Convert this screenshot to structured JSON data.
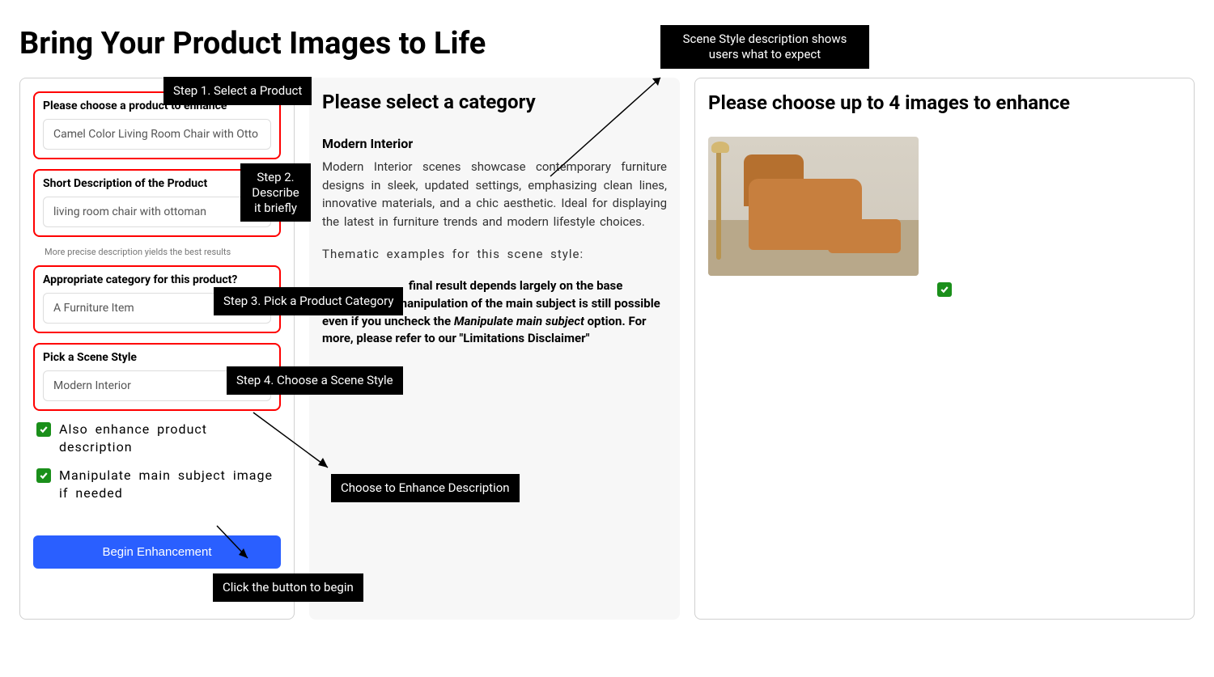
{
  "page_title": "Bring Your Product Images to Life",
  "left": {
    "product_label": "Please choose a product to enhance",
    "product_value": "Camel Color Living Room Chair with Otto",
    "desc_label": "Short Description of the Product",
    "desc_value": "living room chair with ottoman",
    "desc_helper": "More precise description yields the best results",
    "category_label": "Appropriate category for this product?",
    "category_value": "A Furniture Item",
    "scene_label": "Pick a Scene Style",
    "scene_value": "Modern Interior",
    "chk1": "Also enhance product description",
    "chk2": "Manipulate main subject image if needed",
    "begin_btn": "Begin Enhancement"
  },
  "middle": {
    "title": "Please select a category",
    "subtitle": "Modern Interior",
    "body": "Modern Interior scenes showcase contemporary furniture designs in sleek, updated settings, emphasizing clean lines, innovative materials, and a chic aesthetic. Ideal for displaying the latest in furniture trends and modern lifestyle choices.",
    "thematic": "Thematic examples for this scene style:",
    "note_pre": "final result depends largely on the base ",
    "note_mid1": "de. Some manipulation of the main subject is still possible even if you uncheck the ",
    "note_italic": "Manipulate main subject",
    "note_mid2": " option. For more, please refer to our \"Limitations Disclaimer\""
  },
  "right": {
    "title": "Please choose up to 4 images to enhance"
  },
  "callouts": {
    "top": "Scene Style description shows users what to expect",
    "step1": "Step 1. Select a Product",
    "step2": "Step 2. Describe it briefly",
    "step3": "Step 3. Pick a Product Category",
    "step4": "Step 4. Choose a Scene Style",
    "enhance_desc": "Choose to Enhance Description",
    "begin": "Click the button to begin"
  }
}
